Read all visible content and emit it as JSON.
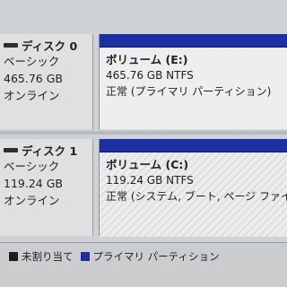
{
  "disks": [
    {
      "title": "ディスク 0",
      "type": "ベーシック",
      "size": "465.76 GB",
      "status": "オンライン",
      "volume": {
        "name": "ボリューム (E:)",
        "size_fs": "465.76 GB NTFS",
        "status": "正常 (プライマリ パーティション)"
      }
    },
    {
      "title": "ディスク 1",
      "type": "ベーシック",
      "size": "119.24 GB",
      "status": "オンライン",
      "volume": {
        "name": "ボリューム (C:)",
        "size_fs": "119.24 GB NTFS",
        "status": "正常 (システム, ブート, ページ ファイル, ク"
      }
    }
  ],
  "legend": {
    "unallocated_label": "未割り当て",
    "primary_label": "プライマリ パーティション",
    "unallocated_color": "#1b1b1b",
    "primary_color": "#1c2fa3"
  }
}
